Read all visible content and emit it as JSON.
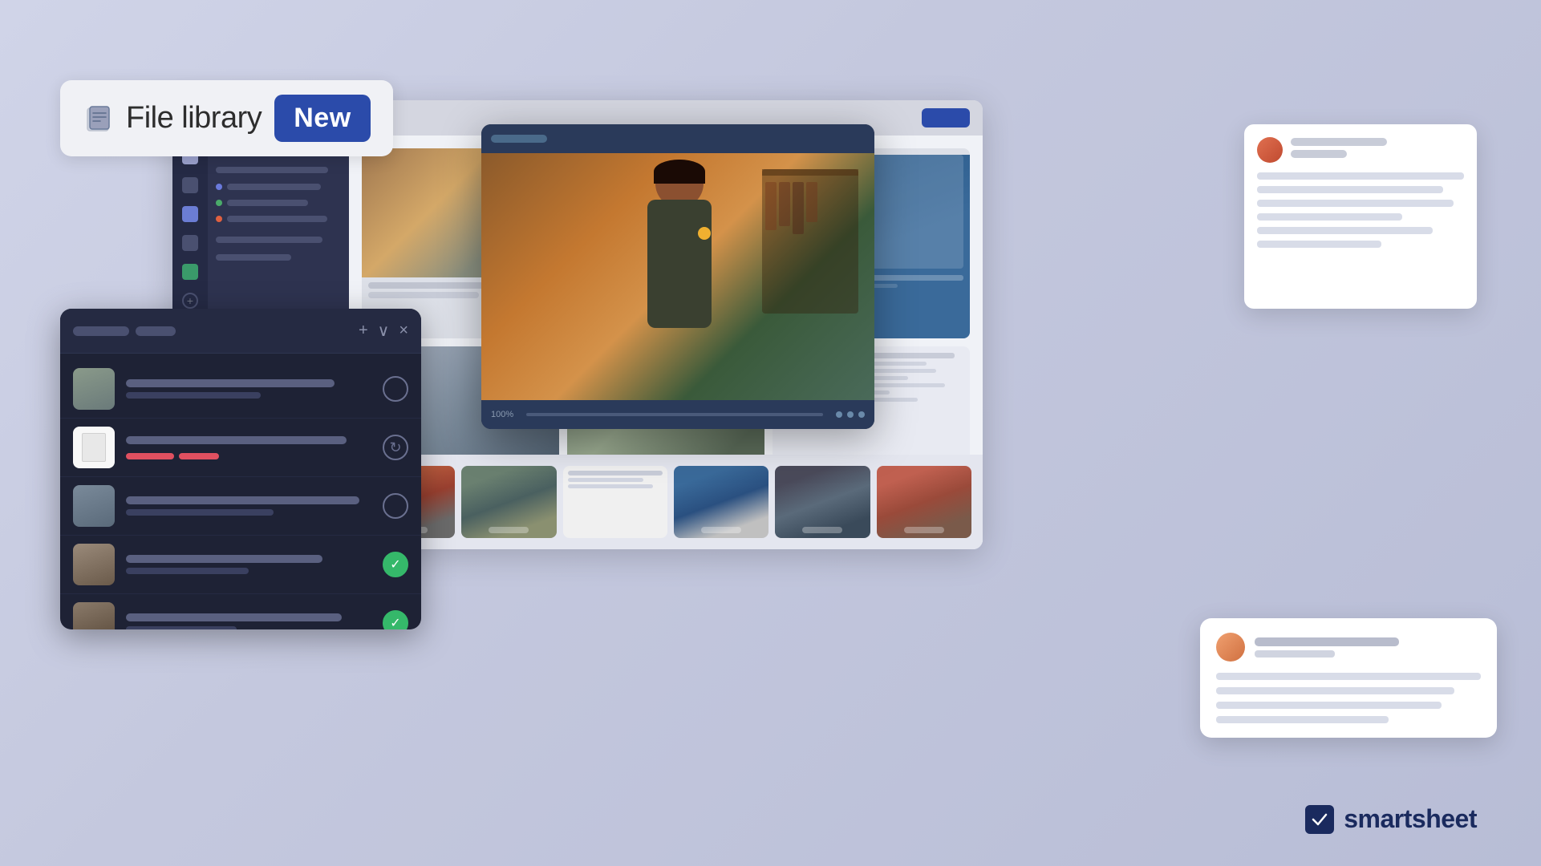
{
  "app": {
    "title": "Smartsheet",
    "brand": "smartsheet"
  },
  "file_library_badge": {
    "icon_name": "file-library-icon",
    "title": "File library",
    "badge_label": "New"
  },
  "main_window": {
    "header_label": "",
    "top_button_label": ""
  },
  "video_overlay": {
    "header_label": "",
    "footer_label": "100%"
  },
  "comment_panel": {
    "user_name": "",
    "sub_label": ""
  },
  "comment_bubble": {
    "user_name": "",
    "title": "",
    "lines": [
      "",
      "",
      "",
      ""
    ]
  },
  "task_panel": {
    "tab1": "",
    "tab2": "",
    "rows": [
      {
        "title": "",
        "sub": "",
        "status": "empty"
      },
      {
        "title": "",
        "sub": "",
        "progress": "red",
        "status": "sync"
      },
      {
        "title": "",
        "sub": "",
        "status": "empty"
      },
      {
        "title": "",
        "sub": "",
        "status": "check"
      },
      {
        "title": "",
        "sub": "",
        "status": "check"
      }
    ]
  },
  "smartsheet_logo": {
    "mark": "✓",
    "text": "smartsheet"
  },
  "colors": {
    "primary_blue": "#2b4baa",
    "dark_bg": "#1e2235",
    "sidebar_bg": "#252a42",
    "accent_green": "#35b86a",
    "accent_red": "#e05060"
  }
}
